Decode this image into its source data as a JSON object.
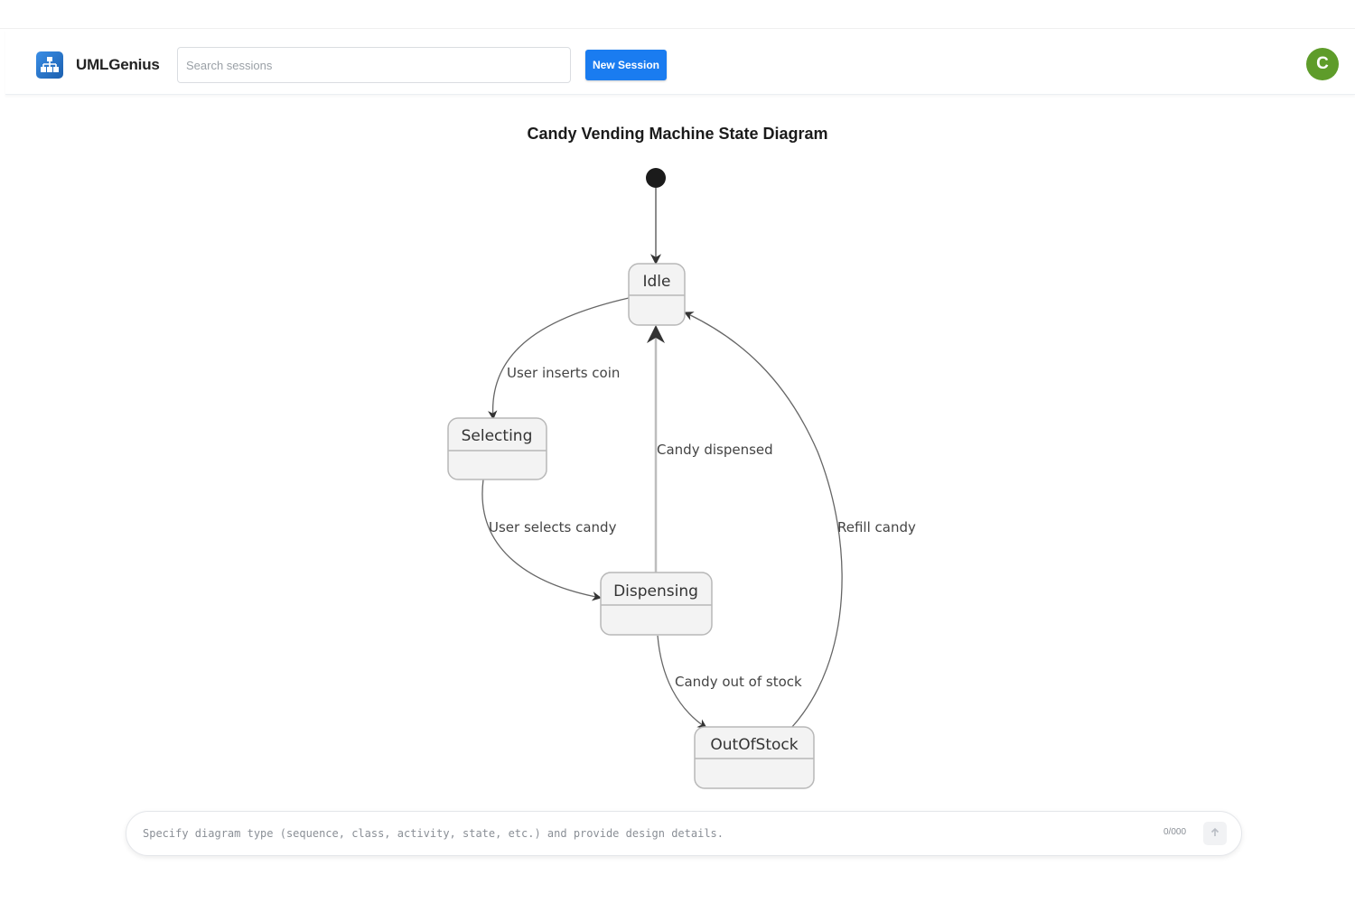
{
  "header": {
    "app_name": "UMLGenius",
    "search_placeholder": "Search sessions",
    "new_session_label": "New Session",
    "avatar_initial": "C",
    "logo_icon": "sitemap-icon"
  },
  "diagram": {
    "title": "Candy Vending Machine State Diagram",
    "states": [
      "Idle",
      "Selecting",
      "Dispensing",
      "OutOfStock"
    ],
    "transitions": [
      {
        "from": "start",
        "to": "Idle",
        "label": ""
      },
      {
        "from": "Idle",
        "to": "Selecting",
        "label": "User inserts coin"
      },
      {
        "from": "Selecting",
        "to": "Dispensing",
        "label": "User selects candy"
      },
      {
        "from": "Dispensing",
        "to": "Idle",
        "label": "Candy dispensed"
      },
      {
        "from": "Dispensing",
        "to": "OutOfStock",
        "label": "Candy out of stock"
      },
      {
        "from": "OutOfStock",
        "to": "Idle",
        "label": "Refill candy"
      }
    ]
  },
  "prompt": {
    "placeholder": "Specify diagram type (sequence, class, activity, state, etc.) and provide design details.",
    "char_count": "0/000",
    "send_icon": "send-arrow-icon"
  },
  "colors": {
    "primary": "#1a7cf0",
    "avatar": "#5e9c2a",
    "state_fill": "#f3f3f3",
    "state_stroke": "#b8b8b8",
    "edge": "#555555"
  }
}
